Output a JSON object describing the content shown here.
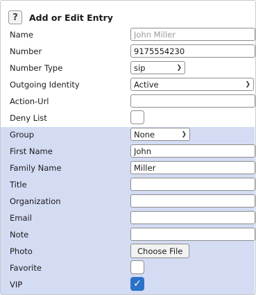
{
  "header": {
    "title": "Add or Edit Entry",
    "help_icon": "question-mark-icon"
  },
  "fields": {
    "name": {
      "label": "Name",
      "placeholder": "John Miller",
      "value": ""
    },
    "number": {
      "label": "Number",
      "value": "9175554230"
    },
    "number_type": {
      "label": "Number Type",
      "selected": "sip"
    },
    "outgoing_identity": {
      "label": "Outgoing Identity",
      "selected": "Active"
    },
    "action_url": {
      "label": "Action-Url",
      "value": ""
    },
    "deny_list": {
      "label": "Deny List",
      "checked": false
    },
    "group": {
      "label": "Group",
      "selected": "None"
    },
    "first_name": {
      "label": "First Name",
      "value": "John"
    },
    "family_name": {
      "label": "Family Name",
      "value": "Miller"
    },
    "title": {
      "label": "Title",
      "value": ""
    },
    "organization": {
      "label": "Organization",
      "value": ""
    },
    "email": {
      "label": "Email",
      "value": ""
    },
    "note": {
      "label": "Note",
      "value": ""
    },
    "photo": {
      "label": "Photo",
      "button_label": "Choose File"
    },
    "favorite": {
      "label": "Favorite",
      "checked": false
    },
    "vip": {
      "label": "VIP",
      "checked": true
    }
  },
  "colors": {
    "band": "#d4dcf4",
    "checkbox_checked": "#2c72c7"
  }
}
